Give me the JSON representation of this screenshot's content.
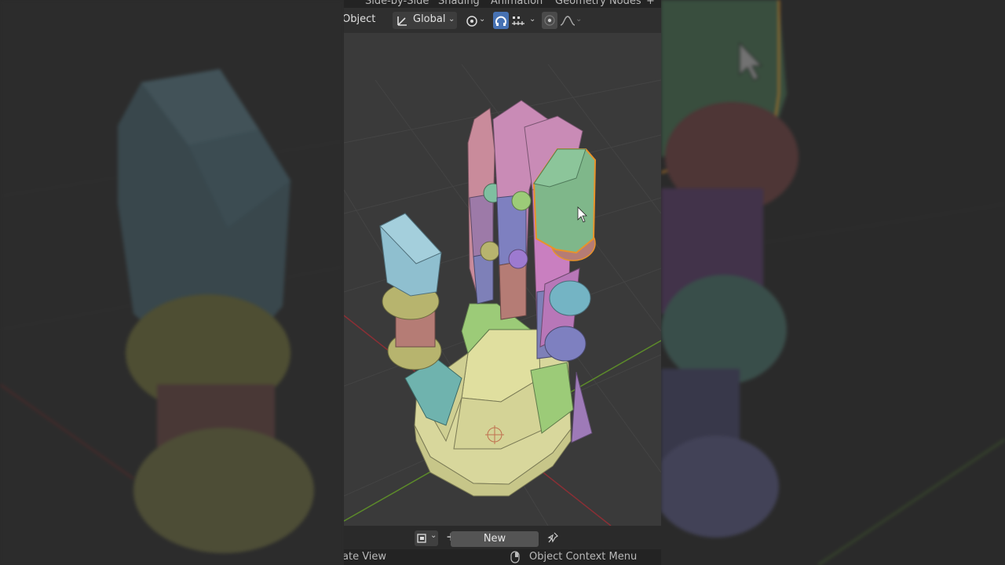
{
  "workspace_tabs": [
    "Side-by-Side",
    "Shading",
    "Animation",
    "Geometry Nodes"
  ],
  "add_tab_symbol": "+",
  "header": {
    "mode_label": "Object",
    "orientation_label": "Global",
    "icons": [
      "transform-orientation-icon",
      "pivot-icon",
      "snap-icon",
      "snap-increment-icon",
      "proportional-edit-icon",
      "falloff-icon"
    ]
  },
  "footer": {
    "new_button_label": "New",
    "plus_symbol": "+"
  },
  "statusbar": {
    "left_text": "ate View",
    "right_text": "Object Context Menu"
  },
  "colors": {
    "selection_outline": "#e8932a",
    "active_button": "#4772b3",
    "viewport_bg": "#3a3a3a"
  }
}
